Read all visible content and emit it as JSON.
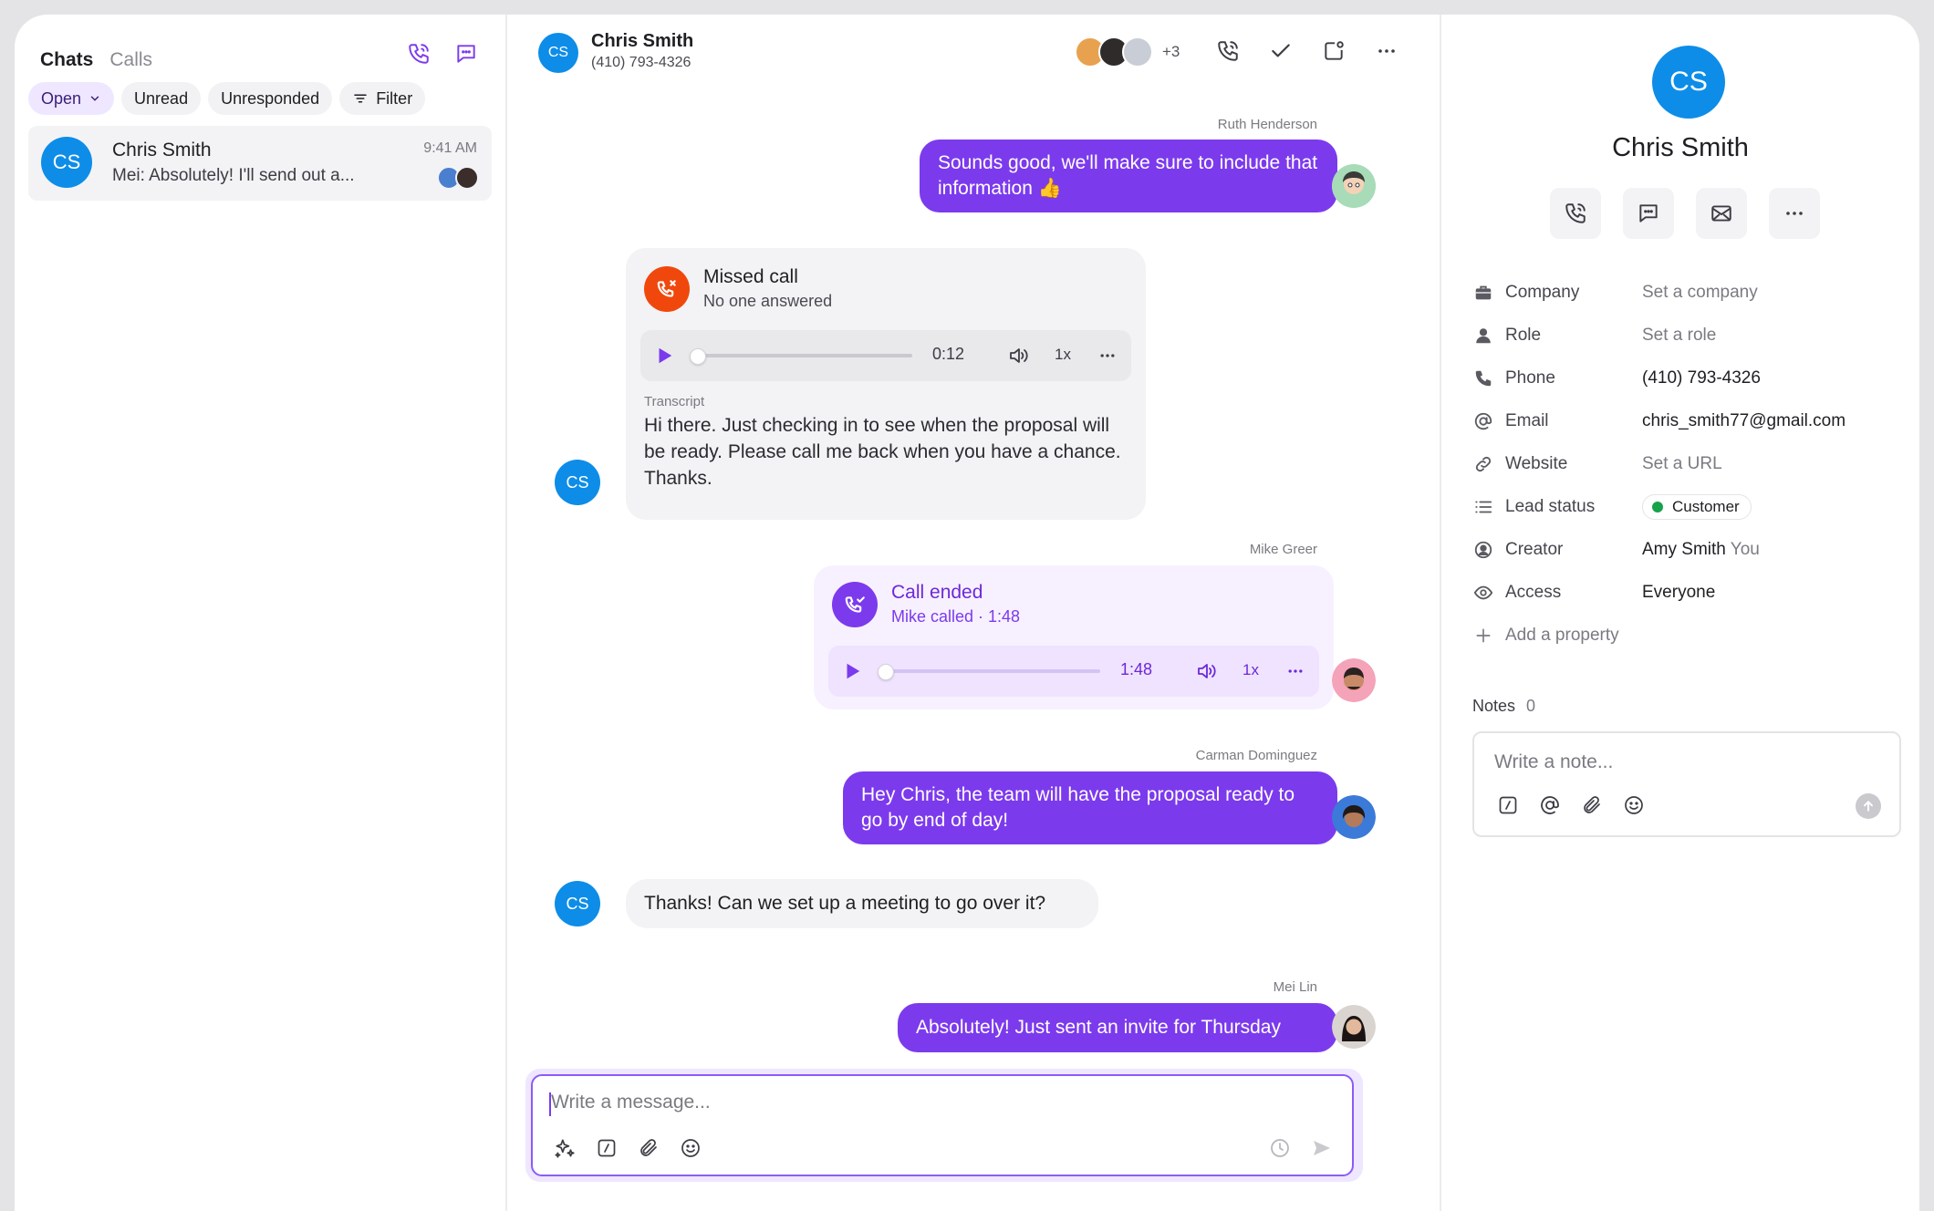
{
  "left": {
    "tabs": {
      "chats": "Chats",
      "calls": "Calls"
    },
    "filters": {
      "open": "Open",
      "unread": "Unread",
      "unresponded": "Unresponded",
      "filter": "Filter"
    },
    "conversation": {
      "initials": "CS",
      "name": "Chris Smith",
      "preview": "Mei: Absolutely! I'll send out a...",
      "time": "9:41 AM"
    }
  },
  "header": {
    "initials": "CS",
    "name": "Chris Smith",
    "phone": "(410) 793-4326",
    "more_participants": "+3"
  },
  "messages": {
    "m1": {
      "sender": "Ruth Henderson",
      "text": "Sounds good, we'll make sure to include that information 👍"
    },
    "missed": {
      "title": "Missed call",
      "subtitle": "No one answered",
      "duration": "0:12",
      "speed": "1x",
      "transcript_label": "Transcript",
      "transcript": "Hi there. Just checking in to see when the proposal will be ready. Please call me back when you have a chance. Thanks.",
      "initials": "CS"
    },
    "ended": {
      "sender": "Mike Greer",
      "title": "Call ended",
      "subtitle": "Mike called · 1:48",
      "duration": "1:48",
      "speed": "1x"
    },
    "m2": {
      "sender": "Carman Dominguez",
      "text": "Hey Chris, the team will have the proposal ready to go by end of day!"
    },
    "m3": {
      "text": "Thanks! Can we set up a meeting to go over it?",
      "initials": "CS"
    },
    "m4": {
      "sender": "Mei Lin",
      "text": "Absolutely! Just sent an invite for Thursday"
    }
  },
  "composer": {
    "placeholder": "Write a message..."
  },
  "contact": {
    "initials": "CS",
    "name": "Chris Smith",
    "properties": [
      {
        "label": "Company",
        "value": "Set a company",
        "empty": true
      },
      {
        "label": "Role",
        "value": "Set a role",
        "empty": true
      },
      {
        "label": "Phone",
        "value": "(410) 793-4326",
        "empty": false
      },
      {
        "label": "Email",
        "value": "chris_smith77@gmail.com",
        "empty": false
      },
      {
        "label": "Website",
        "value": "Set a URL",
        "empty": true
      },
      {
        "label": "Lead status",
        "value": "Customer",
        "empty": false
      },
      {
        "label": "Creator",
        "value": "Amy Smith",
        "suffix": "You",
        "empty": false
      },
      {
        "label": "Access",
        "value": "Everyone",
        "empty": false
      }
    ],
    "add_property": "Add a property",
    "notes_label": "Notes",
    "notes_count": "0",
    "note_placeholder": "Write a note..."
  },
  "colors": {
    "accent": "#7c3aed",
    "avatar_blue": "#0d8de8",
    "missed_red": "#f0480c",
    "customer_green": "#16a34a"
  }
}
